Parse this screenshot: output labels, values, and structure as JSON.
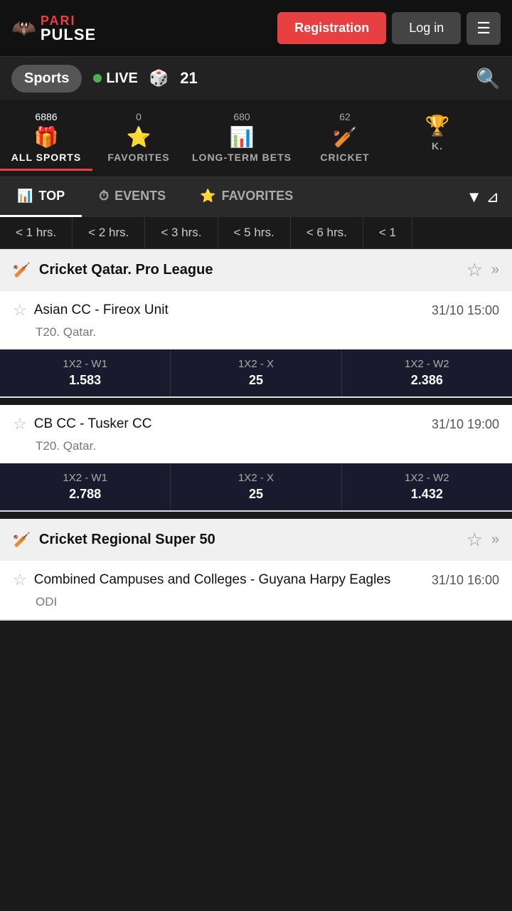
{
  "header": {
    "logo_pari": "PARI",
    "logo_pulse": "PULSE",
    "btn_registration": "Registration",
    "btn_login": "Log in"
  },
  "navbar": {
    "sports_label": "Sports",
    "live_label": "LIVE",
    "live_number": "21",
    "search_icon": "🔍"
  },
  "sports_categories": [
    {
      "id": "all",
      "count": "6886",
      "icon": "🎁",
      "label": "ALL SPORTS",
      "active": true
    },
    {
      "id": "fav",
      "count": "0",
      "icon": "⭐",
      "label": "FAVORITES",
      "active": false
    },
    {
      "id": "longterm",
      "count": "680",
      "icon": "📊",
      "label": "LONG-TERM BETS",
      "active": false
    },
    {
      "id": "cricket",
      "count": "62",
      "icon": "🏏",
      "label": "CRICKET",
      "active": false
    },
    {
      "id": "k",
      "count": "",
      "icon": "🏆",
      "label": "K.",
      "active": false
    }
  ],
  "tabs": [
    {
      "id": "top",
      "icon": "📊",
      "label": "TOP",
      "active": true
    },
    {
      "id": "events",
      "icon": "⏱",
      "label": "EVENTS",
      "active": false
    },
    {
      "id": "favorites",
      "icon": "⭐",
      "label": "FAVORITES",
      "active": false
    }
  ],
  "time_filters": [
    "< 1 hrs.",
    "< 2 hrs.",
    "< 3 hrs.",
    "< 5 hrs.",
    "< 6 hrs.",
    "< 1"
  ],
  "leagues": [
    {
      "id": "cricket-qatar-pro",
      "icon": "🏏",
      "title": "Cricket Qatar. Pro League",
      "matches": [
        {
          "id": "match1",
          "team1": "Asian CC",
          "team2": "Fireox Unit",
          "name": "Asian CC - Fireox Unit",
          "date": "31/10 15:00",
          "type": "T20. Qatar.",
          "bets": [
            {
              "label": "1X2 - W1",
              "value": "1.583"
            },
            {
              "label": "1X2 - X",
              "value": "25"
            },
            {
              "label": "1X2 - W2",
              "value": "2.386"
            }
          ]
        },
        {
          "id": "match2",
          "name": "CB CC - Tusker CC",
          "date": "31/10 19:00",
          "type": "T20. Qatar.",
          "bets": [
            {
              "label": "1X2 - W1",
              "value": "2.788"
            },
            {
              "label": "1X2 - X",
              "value": "25"
            },
            {
              "label": "1X2 - W2",
              "value": "1.432"
            }
          ]
        }
      ]
    },
    {
      "id": "cricket-regional-50",
      "icon": "🏏",
      "title": "Cricket Regional Super 50",
      "matches": [
        {
          "id": "match3",
          "name": "Combined Campuses and Colleges - Guyana Harpy Eagles",
          "date": "31/10 16:00",
          "type": "ODI",
          "bets": []
        }
      ]
    }
  ]
}
